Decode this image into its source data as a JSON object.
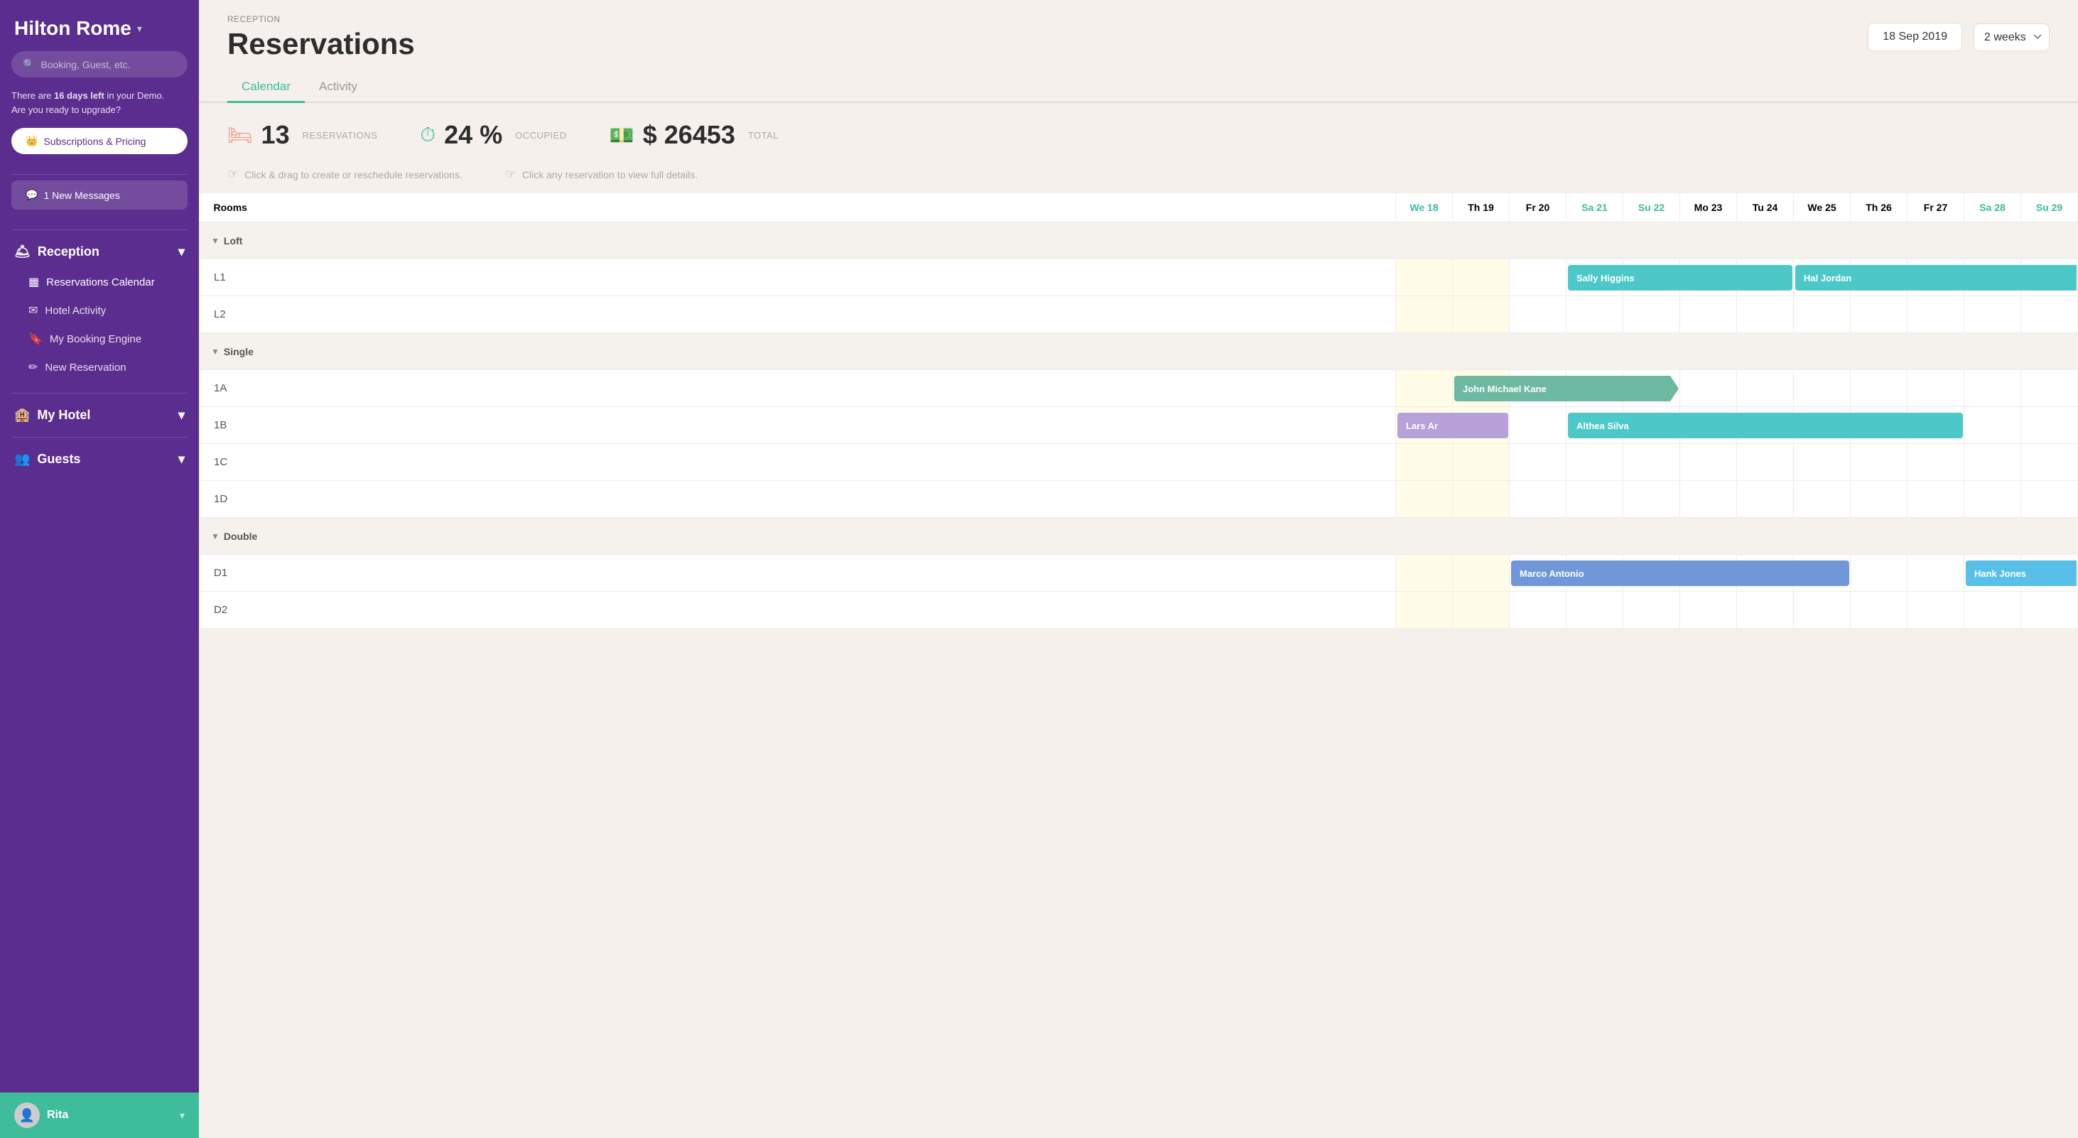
{
  "sidebar": {
    "hotel_name": "Hilton Rome",
    "search_placeholder": "Booking, Guest, etc.",
    "demo_notice": "There are",
    "demo_days": "16 days left",
    "demo_suffix": " in your Demo.\nAre you ready to upgrade?",
    "upgrade_label": "Subscriptions & Pricing",
    "messages_label": "1 New Messages",
    "sections": [
      {
        "name": "Reception",
        "items": [
          {
            "label": "Reservations Calendar",
            "icon": "▦",
            "active": true
          },
          {
            "label": "Hotel Activity",
            "icon": "✉"
          },
          {
            "label": "My Booking Engine",
            "icon": "🔖"
          },
          {
            "label": "New Reservation",
            "icon": "✏"
          }
        ]
      },
      {
        "name": "My Hotel",
        "items": []
      },
      {
        "name": "Guests",
        "items": []
      }
    ],
    "user": {
      "name": "Rita",
      "avatar": "👤"
    }
  },
  "header": {
    "breadcrumb": "RECEPTION",
    "title": "Reservations",
    "date": "18 Sep 2019",
    "view": "2 weeks"
  },
  "tabs": [
    {
      "label": "Calendar",
      "active": true
    },
    {
      "label": "Activity",
      "active": false
    }
  ],
  "stats": {
    "reservations": {
      "count": "13",
      "label": "RESERVATIONS",
      "icon": "🛏"
    },
    "occupied": {
      "percent": "24",
      "label": "OCCUPIED",
      "icon": "⏱"
    },
    "total": {
      "amount": "$ 26453",
      "label": "TOTAL",
      "icon": "💵"
    }
  },
  "hints": [
    {
      "text": "Click & drag to create or reschedule reservations.",
      "icon": "☞"
    },
    {
      "text": "Click any reservation to view full details.",
      "icon": "☞"
    }
  ],
  "calendar": {
    "columns": [
      {
        "label": "Rooms",
        "type": "header"
      },
      {
        "label": "We 18",
        "today": true
      },
      {
        "label": "Th 19",
        "today": false
      },
      {
        "label": "Fr 20",
        "weekend": false
      },
      {
        "label": "Sa 21",
        "weekend": true
      },
      {
        "label": "Su 22",
        "weekend": true
      },
      {
        "label": "Mo 23",
        "weekend": false
      },
      {
        "label": "Tu 24",
        "weekend": false
      },
      {
        "label": "We 25",
        "weekend": false
      },
      {
        "label": "Th 26",
        "weekend": false
      },
      {
        "label": "Fr 27",
        "weekend": false
      },
      {
        "label": "Sa 28",
        "weekend": true
      },
      {
        "label": "Su 29",
        "weekend": true
      }
    ],
    "groups": [
      {
        "name": "Loft",
        "rooms": [
          {
            "name": "L1",
            "reservations": [
              {
                "name": "Sally Higgins",
                "start": 4,
                "span": 4,
                "color": "teal",
                "split": true
              },
              {
                "name": "Hal Jordan",
                "start": 8,
                "span": 5,
                "color": "teal",
                "continues": true
              }
            ]
          },
          {
            "name": "L2",
            "reservations": []
          }
        ]
      },
      {
        "name": "Single",
        "rooms": [
          {
            "name": "1A",
            "reservations": [
              {
                "name": "John Michael Kane",
                "start": 2,
                "span": 4,
                "color": "green",
                "arrow": true
              }
            ]
          },
          {
            "name": "1B",
            "reservations": [
              {
                "name": "Lars Ar",
                "start": 1,
                "span": 2,
                "color": "purple"
              },
              {
                "name": "Althea Silva",
                "start": 4,
                "span": 7,
                "color": "teal"
              }
            ]
          },
          {
            "name": "1C",
            "reservations": []
          },
          {
            "name": "1D",
            "reservations": []
          }
        ]
      },
      {
        "name": "Double",
        "rooms": [
          {
            "name": "D1",
            "reservations": [
              {
                "name": "Marco Antonio",
                "start": 3,
                "span": 6,
                "color": "blue"
              },
              {
                "name": "Hank Jones",
                "start": 11,
                "span": 2,
                "color": "sky",
                "continues": true
              }
            ]
          },
          {
            "name": "D2",
            "reservations": []
          }
        ]
      }
    ]
  }
}
